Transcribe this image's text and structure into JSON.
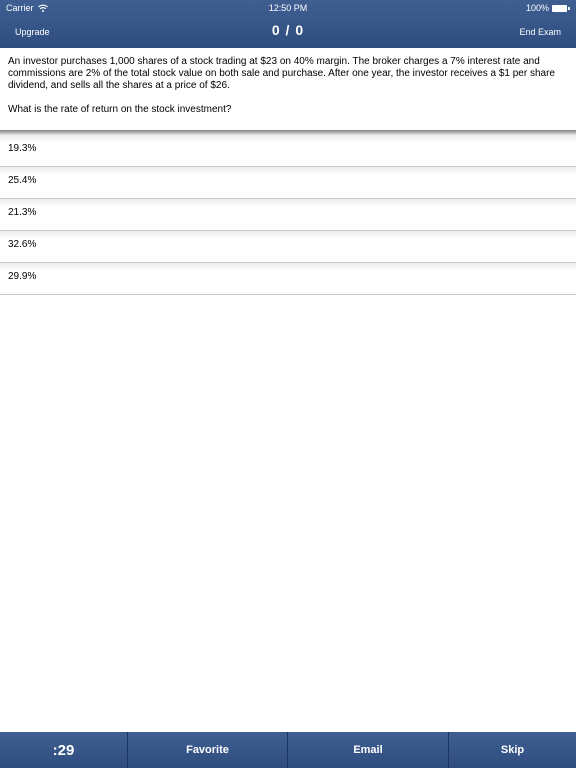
{
  "status_bar": {
    "carrier": "Carrier",
    "time": "12:50 PM",
    "battery": "100%"
  },
  "nav": {
    "left_label": "Upgrade",
    "title": "0 / 0",
    "right_label": "End Exam"
  },
  "question": {
    "text": "An investor purchases 1,000 shares of a stock trading at $23 on 40% margin. The broker charges a 7% interest rate and commissions are 2% of the total stock value on both sale and purchase. After one year, the investor receives a $1 per share dividend, and sells all the shares at a price of $26.",
    "prompt": "What is the rate of return on the stock investment?"
  },
  "answers": [
    "19.3%",
    "25.4%",
    "21.3%",
    "32.6%",
    "29.9%"
  ],
  "toolbar": {
    "timer": ":29",
    "favorite": "Favorite",
    "email": "Email",
    "skip": "Skip"
  },
  "colors": {
    "bar_blue": "#34538a",
    "divider": "#c9c9d2"
  },
  "icons": {
    "wifi": "wifi-icon",
    "battery": "battery-icon"
  }
}
